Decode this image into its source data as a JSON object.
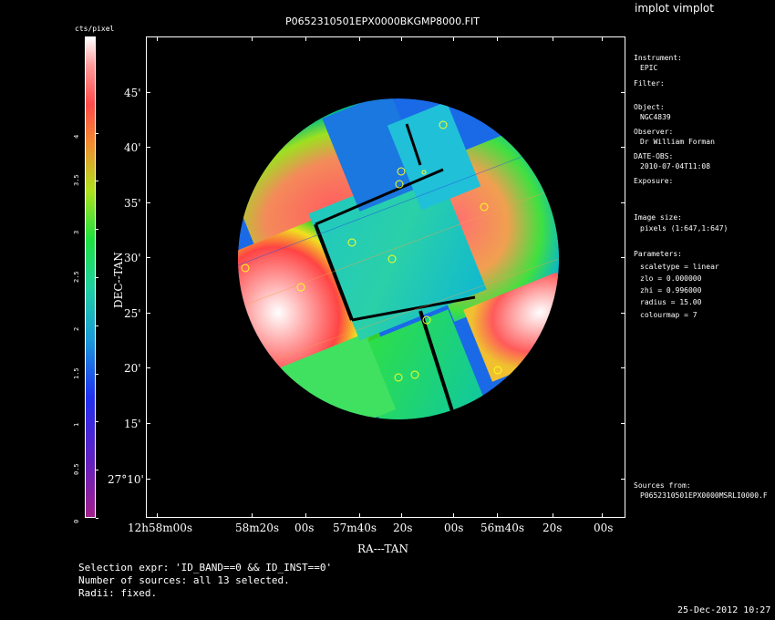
{
  "window_title": "implot vimplot",
  "plot_title": "P0652310501EPX0000BKGMP8000.FIT",
  "colorbar": {
    "label": "cts/pixel",
    "ticks": [
      "0",
      "0.5",
      "1",
      "1.5",
      "2",
      "2.5",
      "3",
      "3.5",
      "4"
    ]
  },
  "axes": {
    "ylabel": "DEC--TAN",
    "xlabel": "RA---TAN",
    "y_ticks": [
      "45'",
      "40'",
      "35'",
      "30'",
      "25'",
      "20'",
      "15'",
      "27°10'"
    ],
    "x_ticks": [
      "12h58m00s",
      "58m20s",
      "00s",
      "57m40s",
      "20s",
      "00s",
      "56m40s",
      "20s",
      "00s"
    ]
  },
  "info": {
    "instrument_label": "Instrument:",
    "instrument_value": "EPIC",
    "filter_label": "Filter:",
    "object_label": "Object:",
    "object_value": "NGC4839",
    "observer_label": "Observer:",
    "observer_value": "Dr William Forman",
    "date_label": "DATE-OBS:",
    "date_value": "2010-07-04T11:08",
    "exposure_label": "Exposure:",
    "image_size_label": "Image size:",
    "image_size_value": "pixels (1:647,1:647)",
    "parameters_label": "Parameters:",
    "param_scaletype": "scaletype = linear",
    "param_zlo": "zlo = 0.000000",
    "param_zhi": "zhi = 0.996000",
    "param_radius": "radius = 15.00",
    "param_colourmap": "colourmap = 7",
    "sources_label": "Sources from:",
    "sources_value": "P0652310501EPX0000MSRLI0000.F"
  },
  "footer": {
    "selection": "Selection expr: 'ID_BAND==0 && ID_INST==0'",
    "num_sources": "Number of sources: all 13 selected.",
    "radii": "Radii: fixed.",
    "timestamp": "25-Dec-2012 10:27"
  }
}
